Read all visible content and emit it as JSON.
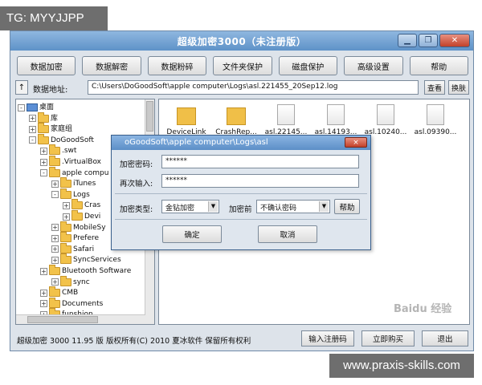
{
  "overlay": {
    "tag_text": "TG: MYYJJPP",
    "bottom_text": "www.praxis-skills.com",
    "baidu_text": "Baidu 经验"
  },
  "window": {
    "title": "超级加密3000（未注册版）",
    "minimize_icon": "minimize-icon",
    "restore_icon": "restore-icon",
    "close_icon": "close-icon"
  },
  "toolbar": {
    "buttons": [
      "数据加密",
      "数据解密",
      "数据粉碎",
      "文件夹保护",
      "磁盘保护",
      "高级设置",
      "帮助"
    ]
  },
  "address": {
    "label": "数据地址:",
    "value": "C:\\Users\\DoGoodSoft\\apple computer\\Logs\\asl.221455_20Sep12.log",
    "view_button": "查看",
    "switch_button": "换肤"
  },
  "tree": {
    "items": [
      {
        "label": "桌面",
        "kind": "computer",
        "expander": "-"
      },
      {
        "label": "库",
        "kind": "folder",
        "expander": "+"
      },
      {
        "label": "家庭组",
        "kind": "folder",
        "expander": "+"
      },
      {
        "label": "DoGoodSoft",
        "kind": "folder",
        "expander": "-"
      },
      {
        "label": ".swt",
        "kind": "folder",
        "expander": "+"
      },
      {
        "label": ".VirtualBox",
        "kind": "folder",
        "expander": "+"
      },
      {
        "label": "apple compu",
        "kind": "folder",
        "expander": "-"
      },
      {
        "label": "iTunes",
        "kind": "folder",
        "expander": "+"
      },
      {
        "label": "Logs",
        "kind": "folder",
        "expander": "-"
      },
      {
        "label": "Cras",
        "kind": "folder",
        "expander": "+"
      },
      {
        "label": "Devi",
        "kind": "folder",
        "expander": "+"
      },
      {
        "label": "MobileSy",
        "kind": "folder",
        "expander": "+"
      },
      {
        "label": "Prefere",
        "kind": "folder",
        "expander": "+"
      },
      {
        "label": "Safari",
        "kind": "folder",
        "expander": "+"
      },
      {
        "label": "SyncServices",
        "kind": "folder",
        "expander": "+"
      },
      {
        "label": "Bluetooth Software",
        "kind": "folder",
        "expander": "+"
      },
      {
        "label": "sync",
        "kind": "folder",
        "expander": "+"
      },
      {
        "label": "CMB",
        "kind": "folder",
        "expander": "+"
      },
      {
        "label": "Documents",
        "kind": "folder",
        "expander": "+"
      },
      {
        "label": "funshion",
        "kind": "folder",
        "expander": "+"
      }
    ]
  },
  "files": [
    {
      "label": "DeviceLink",
      "type": "folder"
    },
    {
      "label": "CrashRep...",
      "type": "folder"
    },
    {
      "label": "asl.22145...",
      "type": "file"
    },
    {
      "label": "asl.14193...",
      "type": "file"
    },
    {
      "label": "asl.10240...",
      "type": "file"
    },
    {
      "label": "asl.09390...",
      "type": "file"
    }
  ],
  "status": {
    "text": "超级加密 3000  11.95 版  版权所有(C) 2010 夏冰软件  保留所有权利",
    "register_button": "输入注册码",
    "buy_button": "立即购买",
    "exit_button": "退出"
  },
  "dialog": {
    "title": "oGoodSoft\\apple computer\\Logs\\asl",
    "close_label": "×",
    "password_label": "加密密码:",
    "password_value": "******",
    "confirm_label": "再次输入:",
    "confirm_value": "******",
    "type_label": "加密类型:",
    "type_value": "金钻加密",
    "before_label": "加密前",
    "before_value": "不确认密码",
    "help_button": "帮助",
    "ok_button": "确定",
    "cancel_button": "取消"
  }
}
